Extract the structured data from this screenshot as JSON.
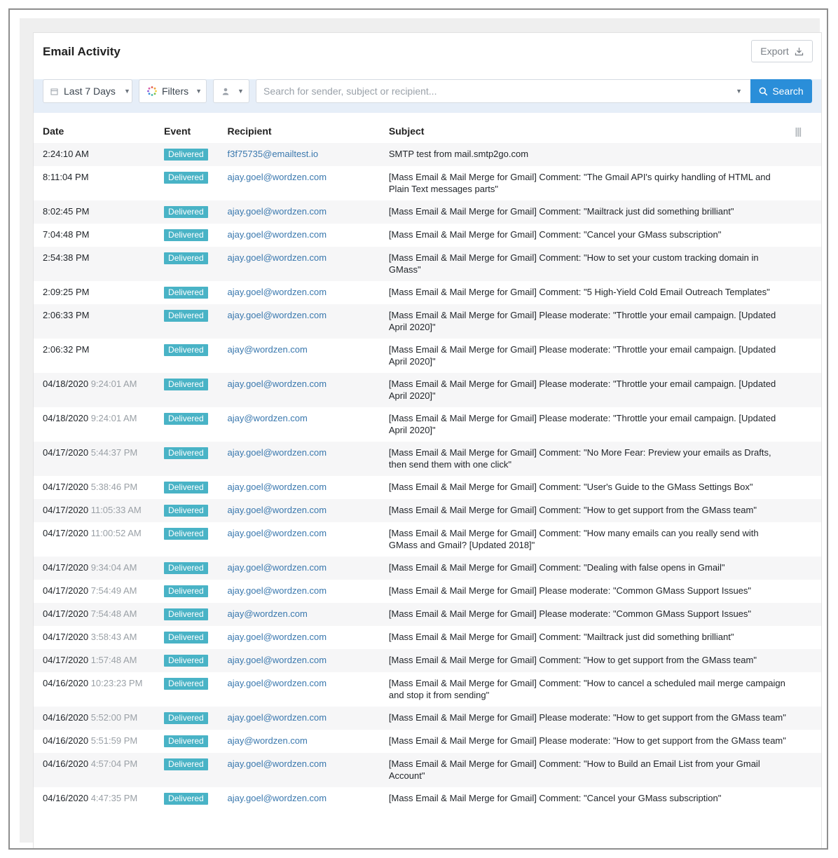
{
  "header": {
    "title": "Email Activity",
    "export_label": "Export"
  },
  "toolbar": {
    "date_range": "Last 7 Days",
    "filters_label": "Filters",
    "search_placeholder": "Search for sender, subject or recipient...",
    "search_button": "Search"
  },
  "table": {
    "columns": [
      "Date",
      "Event",
      "Recipient",
      "Subject"
    ],
    "rows": [
      {
        "date": "",
        "time": "2:24:10 AM",
        "event": "Delivered",
        "recipient": "f3f75735@emailtest.io",
        "subject": "SMTP test from mail.smtp2go.com"
      },
      {
        "date": "",
        "time": "8:11:04 PM",
        "event": "Delivered",
        "recipient": "ajay.goel@wordzen.com",
        "subject": "[Mass Email & Mail Merge for Gmail] Comment: \"The Gmail API's quirky handling of HTML and Plain Text messages parts\""
      },
      {
        "date": "",
        "time": "8:02:45 PM",
        "event": "Delivered",
        "recipient": "ajay.goel@wordzen.com",
        "subject": "[Mass Email & Mail Merge for Gmail] Comment: \"Mailtrack just did something brilliant\""
      },
      {
        "date": "",
        "time": "7:04:48 PM",
        "event": "Delivered",
        "recipient": "ajay.goel@wordzen.com",
        "subject": "[Mass Email & Mail Merge for Gmail] Comment: \"Cancel your GMass subscription\""
      },
      {
        "date": "",
        "time": "2:54:38 PM",
        "event": "Delivered",
        "recipient": "ajay.goel@wordzen.com",
        "subject": "[Mass Email & Mail Merge for Gmail] Comment: \"How to set your custom tracking domain in GMass\""
      },
      {
        "date": "",
        "time": "2:09:25 PM",
        "event": "Delivered",
        "recipient": "ajay.goel@wordzen.com",
        "subject": "[Mass Email & Mail Merge for Gmail] Comment: \"5 High-Yield Cold Email Outreach Templates\""
      },
      {
        "date": "",
        "time": "2:06:33 PM",
        "event": "Delivered",
        "recipient": "ajay.goel@wordzen.com",
        "subject": "[Mass Email & Mail Merge for Gmail] Please moderate: \"Throttle your email campaign. [Updated April 2020]\""
      },
      {
        "date": "",
        "time": "2:06:32 PM",
        "event": "Delivered",
        "recipient": "ajay@wordzen.com",
        "subject": "[Mass Email & Mail Merge for Gmail] Please moderate: \"Throttle your email campaign. [Updated April 2020]\""
      },
      {
        "date": "04/18/2020",
        "time": "9:24:01 AM",
        "event": "Delivered",
        "recipient": "ajay.goel@wordzen.com",
        "subject": "[Mass Email & Mail Merge for Gmail] Please moderate: \"Throttle your email campaign. [Updated April 2020]\""
      },
      {
        "date": "04/18/2020",
        "time": "9:24:01 AM",
        "event": "Delivered",
        "recipient": "ajay@wordzen.com",
        "subject": "[Mass Email & Mail Merge for Gmail] Please moderate: \"Throttle your email campaign. [Updated April 2020]\""
      },
      {
        "date": "04/17/2020",
        "time": "5:44:37 PM",
        "event": "Delivered",
        "recipient": "ajay.goel@wordzen.com",
        "subject": "[Mass Email & Mail Merge for Gmail] Comment: \"No More Fear: Preview your emails as Drafts, then send them with one click\""
      },
      {
        "date": "04/17/2020",
        "time": "5:38:46 PM",
        "event": "Delivered",
        "recipient": "ajay.goel@wordzen.com",
        "subject": "[Mass Email & Mail Merge for Gmail] Comment: \"User's Guide to the GMass Settings Box\""
      },
      {
        "date": "04/17/2020",
        "time": "11:05:33 AM",
        "event": "Delivered",
        "recipient": "ajay.goel@wordzen.com",
        "subject": "[Mass Email & Mail Merge for Gmail] Comment: \"How to get support from the GMass team\""
      },
      {
        "date": "04/17/2020",
        "time": "11:00:52 AM",
        "event": "Delivered",
        "recipient": "ajay.goel@wordzen.com",
        "subject": "[Mass Email & Mail Merge for Gmail] Comment: \"How many emails can you really send with GMass and Gmail? [Updated 2018]\""
      },
      {
        "date": "04/17/2020",
        "time": "9:34:04 AM",
        "event": "Delivered",
        "recipient": "ajay.goel@wordzen.com",
        "subject": "[Mass Email & Mail Merge for Gmail] Comment: \"Dealing with false opens in Gmail\""
      },
      {
        "date": "04/17/2020",
        "time": "7:54:49 AM",
        "event": "Delivered",
        "recipient": "ajay.goel@wordzen.com",
        "subject": "[Mass Email & Mail Merge for Gmail] Please moderate: \"Common GMass Support Issues\""
      },
      {
        "date": "04/17/2020",
        "time": "7:54:48 AM",
        "event": "Delivered",
        "recipient": "ajay@wordzen.com",
        "subject": "[Mass Email & Mail Merge for Gmail] Please moderate: \"Common GMass Support Issues\""
      },
      {
        "date": "04/17/2020",
        "time": "3:58:43 AM",
        "event": "Delivered",
        "recipient": "ajay.goel@wordzen.com",
        "subject": "[Mass Email & Mail Merge for Gmail] Comment: \"Mailtrack just did something brilliant\""
      },
      {
        "date": "04/17/2020",
        "time": "1:57:48 AM",
        "event": "Delivered",
        "recipient": "ajay.goel@wordzen.com",
        "subject": "[Mass Email & Mail Merge for Gmail] Comment: \"How to get support from the GMass team\""
      },
      {
        "date": "04/16/2020",
        "time": "10:23:23 PM",
        "event": "Delivered",
        "recipient": "ajay.goel@wordzen.com",
        "subject": "[Mass Email & Mail Merge for Gmail] Comment: \"How to cancel a scheduled mail merge campaign and stop it from sending\""
      },
      {
        "date": "04/16/2020",
        "time": "5:52:00 PM",
        "event": "Delivered",
        "recipient": "ajay.goel@wordzen.com",
        "subject": "[Mass Email & Mail Merge for Gmail] Please moderate: \"How to get support from the GMass team\""
      },
      {
        "date": "04/16/2020",
        "time": "5:51:59 PM",
        "event": "Delivered",
        "recipient": "ajay@wordzen.com",
        "subject": "[Mass Email & Mail Merge for Gmail] Please moderate: \"How to get support from the GMass team\""
      },
      {
        "date": "04/16/2020",
        "time": "4:57:04 PM",
        "event": "Delivered",
        "recipient": "ajay.goel@wordzen.com",
        "subject": "[Mass Email & Mail Merge for Gmail] Comment: \"How to Build an Email List from your Gmail Account\""
      },
      {
        "date": "04/16/2020",
        "time": "4:47:35 PM",
        "event": "Delivered",
        "recipient": "ajay.goel@wordzen.com",
        "subject": "[Mass Email & Mail Merge for Gmail] Comment: \"Cancel your GMass subscription\""
      }
    ]
  },
  "colors": {
    "accent": "#2a8ed9",
    "badge": "#49b3c6",
    "link": "#3a78ae",
    "toolbar_bg": "#e6eef8"
  },
  "icons": {
    "export": "download-icon",
    "date": "calendar-icon",
    "filters": "spinner-icon",
    "user": "user-icon",
    "search": "search-icon",
    "columns": "column-menu-icon"
  }
}
